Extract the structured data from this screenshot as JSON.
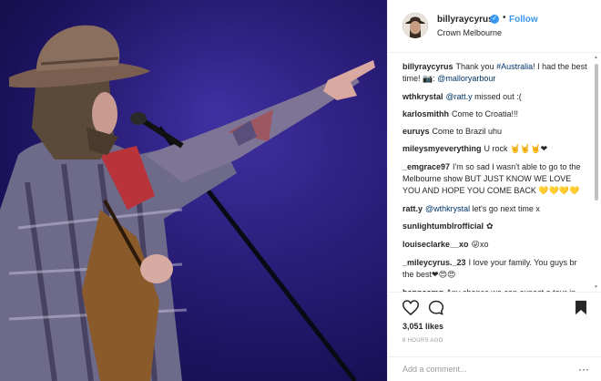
{
  "post": {
    "username": "billyraycyrus",
    "verified_icon": "verified-badge-icon",
    "separator": "•",
    "follow_label": "Follow",
    "location": "Crown Melbourne"
  },
  "comments": [
    {
      "user": "billyraycyrus",
      "parts": [
        {
          "t": "Thank you "
        },
        {
          "t": "#Australia",
          "tag": true
        },
        {
          "t": "! I had the best time! "
        },
        {
          "t": "📷",
          "emoji": true
        },
        {
          "t": ": "
        },
        {
          "t": "@malloryarbour",
          "tag": true
        }
      ]
    },
    {
      "user": "wthkrystal",
      "parts": [
        {
          "t": "@ratt.y",
          "tag": true
        },
        {
          "t": " missed out :("
        }
      ]
    },
    {
      "user": "karlosmithh",
      "parts": [
        {
          "t": "Come to Croatia!!!"
        }
      ]
    },
    {
      "user": "euruys",
      "parts": [
        {
          "t": "Come to Brazil uhu"
        }
      ]
    },
    {
      "user": "mileysmyeverything",
      "parts": [
        {
          "t": "U rock "
        },
        {
          "t": "🤘🤘🤘❤",
          "emoji": true
        }
      ]
    },
    {
      "user": "_emgrace97",
      "parts": [
        {
          "t": "I'm so sad I wasn't able to go to the Melbourne show BUT JUST KNOW WE LOVE YOU AND HOPE YOU COME BACK "
        },
        {
          "t": "💛💛💛💛",
          "emoji": true
        }
      ]
    },
    {
      "user": "ratt.y",
      "parts": [
        {
          "t": "@wthkrystal",
          "tag": true
        },
        {
          "t": " let's go next time x"
        }
      ]
    },
    {
      "user": "sunlightumblrofficial",
      "parts": [
        {
          "t": "✿",
          "emoji": true
        }
      ]
    },
    {
      "user": "louiseclarke__xo",
      "parts": [
        {
          "t": "😜",
          "emoji": true
        },
        {
          "t": "xo"
        }
      ]
    },
    {
      "user": "_mileycyrus._23",
      "parts": [
        {
          "t": "I love your family. You guys br the best"
        },
        {
          "t": "❤😍😍",
          "emoji": true
        }
      ]
    },
    {
      "user": "hannasmg",
      "parts": [
        {
          "t": "Any chance we can expect a tour in Germany? Would love going to hear the"
        }
      ]
    }
  ],
  "actions": {
    "like_icon": "heart-icon",
    "comment_icon": "comment-bubble-icon",
    "save_icon": "bookmark-icon",
    "likes": "3,051 likes",
    "timestamp": "8 HOURS AGO",
    "comment_placeholder": "Add a comment...",
    "more_icon": "more-options-icon",
    "more_label": "···"
  },
  "colors": {
    "link": "#3897f0",
    "hashtag": "#003569",
    "stage_bg": "#2a1d7a"
  }
}
